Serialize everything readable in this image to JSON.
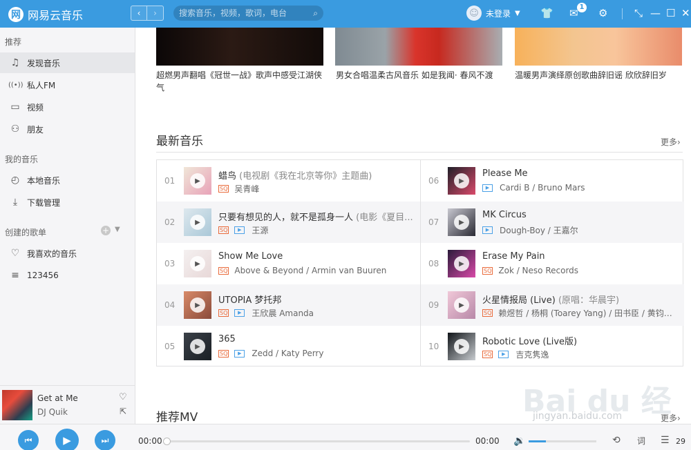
{
  "app": {
    "logo_glyph": "网",
    "name": "网易云音乐"
  },
  "titlebar": {
    "back_arrow": "‹",
    "forward_arrow": "›",
    "search_placeholder": "搜索音乐，视频，歌词，电台",
    "login_text": "未登录",
    "mail_badge": "1"
  },
  "sidebar": {
    "section_recommend": "推荐",
    "items_recommend": [
      {
        "label": "发现音乐",
        "icon": "♫"
      },
      {
        "label": "私人FM",
        "icon": "((•))"
      },
      {
        "label": "视频",
        "icon": "▭"
      },
      {
        "label": "朋友",
        "icon": "⚇"
      }
    ],
    "section_my_music": "我的音乐",
    "items_my_music": [
      {
        "label": "本地音乐",
        "icon": "◴"
      },
      {
        "label": "下载管理",
        "icon": "⤓"
      }
    ],
    "section_created": "创建的歌单",
    "items_created": [
      {
        "label": "我喜欢的音乐",
        "icon": "♡"
      },
      {
        "label": "123456",
        "icon": "≡"
      }
    ]
  },
  "now_playing": {
    "title": "Get at Me",
    "artist": "DJ Quik"
  },
  "videos": [
    {
      "caption": "超燃男声翻唱《冠世一战》歌声中感受江湖侠气"
    },
    {
      "caption": "男女合唱温柔古风音乐 如是我闻· 春风不渡"
    },
    {
      "caption": "温暖男声演绎原创歌曲辞旧谣 欣欣辞旧岁"
    }
  ],
  "latest_music": {
    "title": "最新音乐",
    "more": "更多",
    "left": [
      {
        "num": "01",
        "title": "蜡鸟",
        "subtitle": "(电视剧《我在北京等你》主题曲)",
        "artist": "吴青峰",
        "mv": false,
        "cover": [
          "#f0e6d8",
          "#e8a2b8"
        ]
      },
      {
        "num": "02",
        "title": "只要有想见的人，就不是孤身一人",
        "subtitle": "(电影《夏目...",
        "artist": "王源",
        "mv": true,
        "cover": [
          "#dde8ee",
          "#aac8d8"
        ]
      },
      {
        "num": "03",
        "title": "Show Me Love",
        "subtitle": "",
        "artist": "Above & Beyond / Armin van Buuren",
        "mv": false,
        "cover": [
          "#f4f0f0",
          "#e8d8d8"
        ]
      },
      {
        "num": "04",
        "title": "UTOPIA 梦托邦",
        "subtitle": "",
        "artist": "王欣晨 Amanda",
        "mv": true,
        "cover": [
          "#d88a68",
          "#8a4a3a"
        ]
      },
      {
        "num": "05",
        "title": "365",
        "subtitle": "",
        "artist": "Zedd / Katy Perry",
        "mv": true,
        "cover": [
          "#3a4048",
          "#1a1f24"
        ]
      }
    ],
    "right": [
      {
        "num": "06",
        "title": "Please Me",
        "subtitle": "",
        "artist": "Cardi B / Bruno Mars",
        "mv": true,
        "sq": false,
        "cover": [
          "#1f1f28",
          "#d94a6a"
        ]
      },
      {
        "num": "07",
        "title": "MK Circus",
        "subtitle": "",
        "artist": "Dough-Boy / 王嘉尔",
        "mv": true,
        "sq": false,
        "cover": [
          "#c8c8d0",
          "#2a2a34"
        ]
      },
      {
        "num": "08",
        "title": "Erase My Pain",
        "subtitle": "",
        "artist": "Zok / Neso Records",
        "mv": false,
        "sq": true,
        "cover": [
          "#2a1a3a",
          "#d84aa8"
        ]
      },
      {
        "num": "09",
        "title": "火星情报局 (Live)",
        "subtitle": "(原唱：华晨宇)",
        "artist": "赖煜哲 / 杨桐 (Toarey Yang) / 田书臣 / 黄钧泽 ...",
        "mv": false,
        "sq": true,
        "cover": [
          "#f0c8d8",
          "#b888a8"
        ]
      },
      {
        "num": "10",
        "title": "Robotic Love (Live版)",
        "subtitle": "",
        "artist": "吉克隽逸",
        "mv": true,
        "sq": true,
        "cover": [
          "#101418",
          "#c8ccd0"
        ]
      }
    ]
  },
  "recommend_mv": {
    "title": "推荐MV",
    "more": "更多"
  },
  "watermark": {
    "text": "Bai du 经验",
    "url": "jingyan.baidu.com"
  },
  "player": {
    "time_current": "00:00",
    "time_total": "00:00",
    "volume": 0.25,
    "lyric_label": "词",
    "playlist_count": "29"
  },
  "colors": {
    "accent": "#3a9be0",
    "sq_badge": "#e96a3a",
    "mv_badge": "#4aa0e6"
  }
}
